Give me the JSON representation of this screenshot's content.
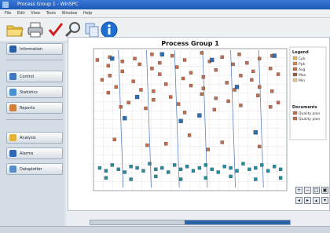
{
  "window": {
    "title": "Process Group 1 - WinSPC"
  },
  "menu": [
    "File",
    "Edit",
    "View",
    "Tools",
    "Window",
    "Help"
  ],
  "toolbar": {
    "icons": [
      "open-folder-icon",
      "print-icon",
      "checkmark-icon",
      "search-icon",
      "copy-icon",
      "info-icon"
    ]
  },
  "sidebar": {
    "items": [
      {
        "label": "Information",
        "icon": "info-icon"
      },
      {
        "label": "Control",
        "icon": "chart-icon"
      },
      {
        "label": "Statistics",
        "icon": "stats-icon"
      },
      {
        "label": "Reports",
        "icon": "report-icon"
      },
      {
        "label": "Analysis",
        "icon": "pencil-icon"
      },
      {
        "label": "Alarms",
        "icon": "alarm-icon"
      },
      {
        "label": "Dataplotter",
        "icon": "plot-icon"
      }
    ]
  },
  "colors": {
    "accent": "#1c58b8",
    "grid": "#e3c7c7",
    "series_a": "#c76b4b",
    "series_b": "#2d6fb5",
    "series_c": "#1f8fa2"
  },
  "chart_data": {
    "type": "scatter",
    "title": "Process Group 1",
    "xlabel": "",
    "ylabel": "",
    "legend": {
      "position": "right",
      "title": "Legend",
      "entries": [
        "Cpk",
        "Ppk",
        "Avg",
        "Max",
        "Min"
      ],
      "subtitle": "Documents",
      "sub_entries": [
        "Quality plan",
        "Quality plan"
      ]
    },
    "series": [
      {
        "values": [
          [
            1,
            9.2
          ],
          [
            1,
            7.8
          ],
          [
            2,
            8.8
          ],
          [
            2,
            6.9
          ],
          [
            3,
            9.4
          ],
          [
            3,
            8.1
          ],
          [
            4,
            7.3
          ],
          [
            4,
            5.9
          ],
          [
            5,
            9.1
          ],
          [
            5,
            8.4
          ],
          [
            6,
            6.2
          ],
          [
            6,
            7.7
          ],
          [
            7,
            9.3
          ],
          [
            7,
            8.9
          ],
          [
            8,
            7.1
          ],
          [
            8,
            5.8
          ],
          [
            9,
            8.6
          ],
          [
            9,
            9.6
          ],
          [
            10,
            7.0
          ],
          [
            10,
            6.4
          ],
          [
            11,
            9.0
          ],
          [
            11,
            8.2
          ],
          [
            12,
            7.5
          ],
          [
            12,
            6.6
          ],
          [
            13,
            9.5
          ],
          [
            13,
            8.7
          ],
          [
            14,
            7.9
          ],
          [
            14,
            6.1
          ],
          [
            15,
            9.2
          ],
          [
            15,
            5.5
          ],
          [
            16,
            8.3
          ],
          [
            16,
            7.4
          ],
          [
            17,
            9.7
          ],
          [
            17,
            6.8
          ],
          [
            18,
            8.0
          ],
          [
            18,
            7.2
          ],
          [
            19,
            9.1
          ],
          [
            19,
            5.7
          ],
          [
            20,
            8.5
          ],
          [
            20,
            6.5
          ],
          [
            21,
            9.4
          ],
          [
            21,
            7.6
          ],
          [
            22,
            8.9
          ],
          [
            22,
            6.3
          ],
          [
            23,
            9.6
          ],
          [
            23,
            7.1
          ],
          [
            24,
            8.1
          ],
          [
            24,
            6.0
          ],
          [
            25,
            9.0
          ],
          [
            25,
            7.8
          ],
          [
            26,
            8.4
          ],
          [
            26,
            6.7
          ],
          [
            27,
            9.3
          ],
          [
            27,
            7.3
          ],
          [
            28,
            8.6
          ],
          [
            28,
            5.9
          ],
          [
            29,
            9.5
          ],
          [
            29,
            7.0
          ],
          [
            30,
            8.2
          ],
          [
            30,
            6.2
          ],
          [
            3,
            3.6
          ],
          [
            9,
            3.2
          ],
          [
            15,
            3.9
          ],
          [
            21,
            3.4
          ],
          [
            27,
            3.1
          ],
          [
            12,
            3.3
          ],
          [
            18,
            2.9
          ]
        ]
      },
      {
        "values": [
          [
            3,
            9.3
          ],
          [
            7,
            6.6
          ],
          [
            11,
            9.6
          ],
          [
            14,
            4.9
          ],
          [
            19,
            9.2
          ],
          [
            23,
            7.3
          ],
          [
            26,
            4.1
          ],
          [
            29,
            9.5
          ],
          [
            5,
            5.1
          ],
          [
            17,
            5.3
          ]
        ]
      },
      {
        "values": [
          [
            1,
            1.6
          ],
          [
            2,
            1.4
          ],
          [
            3,
            1.8
          ],
          [
            4,
            1.5
          ],
          [
            5,
            1.3
          ],
          [
            6,
            1.7
          ],
          [
            7,
            1.6
          ],
          [
            8,
            1.4
          ],
          [
            9,
            1.9
          ],
          [
            10,
            1.5
          ],
          [
            11,
            1.6
          ],
          [
            12,
            1.3
          ],
          [
            13,
            1.8
          ],
          [
            14,
            1.5
          ],
          [
            15,
            1.7
          ],
          [
            16,
            1.4
          ],
          [
            17,
            1.6
          ],
          [
            18,
            1.8
          ],
          [
            19,
            1.5
          ],
          [
            20,
            1.3
          ],
          [
            21,
            1.7
          ],
          [
            22,
            1.6
          ],
          [
            23,
            1.4
          ],
          [
            24,
            1.9
          ],
          [
            25,
            1.5
          ],
          [
            26,
            1.6
          ],
          [
            27,
            1.8
          ],
          [
            28,
            1.4
          ],
          [
            29,
            1.7
          ],
          [
            30,
            1.5
          ],
          [
            2,
            0.9
          ],
          [
            6,
            0.8
          ],
          [
            10,
            1.0
          ],
          [
            14,
            0.8
          ],
          [
            18,
            0.9
          ],
          [
            22,
            1.0
          ],
          [
            26,
            0.8
          ],
          [
            30,
            0.9
          ]
        ]
      }
    ],
    "xlim": [
      0,
      31
    ],
    "ylim": [
      0,
      10
    ],
    "grid": true
  }
}
